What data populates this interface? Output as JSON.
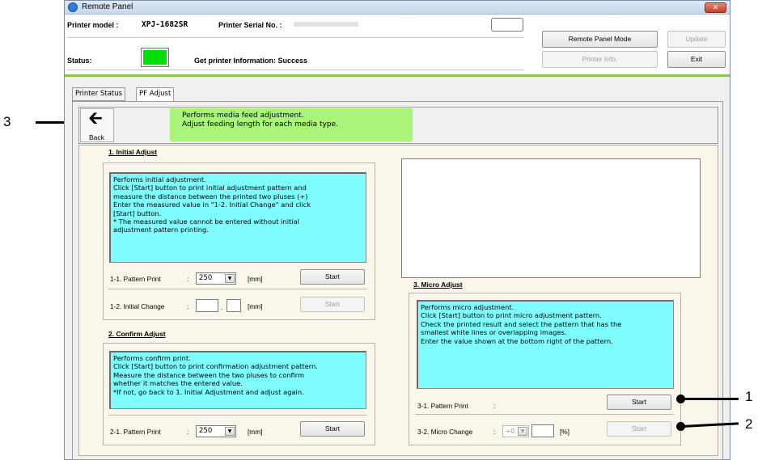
{
  "window": {
    "title": "Remote Panel",
    "close_symbol": "✕"
  },
  "header": {
    "printer_model_label": "Printer model :",
    "printer_model_value": "XPJ-1682SR",
    "serial_label": "Printer Serial No. :",
    "status_label": "Status:",
    "status_color": "#00e000",
    "status_message": "Get printer Information: Success",
    "remote_panel_mode_button": "Remote Panel Mode",
    "update_button": "Update",
    "printer_info_button": "Printer Info.",
    "exit_button": "Exit"
  },
  "tabs": [
    {
      "label": "Printer Status"
    },
    {
      "label": "PF Adjust"
    }
  ],
  "toolbar": {
    "back_label": "Back",
    "back_arrow": "🡰",
    "description": "Performs media feed adjustment.\nAdjust feeding length for each media type."
  },
  "initial_adjust": {
    "title": "1.   Initial Adjust",
    "description": "Performs initial adjustment.\nClick [Start] button to print initial adjustment pattern and\nmeasure the distance between the printed two pluses (+)\nEnter the measured value in \"1-2. Initial Change\" and click\n[Start] button.\n * The measured value cannot be entered without initial\nadjustment pattern printing.",
    "pattern_print_label": "1-1.   Pattern Print",
    "pattern_print_colon": ":",
    "pattern_print_value": "250",
    "pattern_print_unit": "[mm]",
    "pattern_print_button": "Start",
    "initial_change_label": "1-2.   Initial Change",
    "initial_change_colon": ":",
    "initial_change_sep": ".",
    "initial_change_unit": "[mm]",
    "initial_change_button": "Start"
  },
  "confirm_adjust": {
    "title": "2.   Confirm Adjust",
    "description": "Performs confirm print.\nClick [Start] button to print confirmation adjustment pattern.\nMeasure the distance between the two pluses to confirm\nwhether it matches the entered value.\n*If not, go back to 1. Initial Adjustment and adjust again.",
    "pattern_print_label": "2-1.   Pattern Print",
    "pattern_print_colon": ":",
    "pattern_print_value": "250",
    "pattern_print_unit": "[mm]",
    "pattern_print_button": "Start"
  },
  "micro_adjust": {
    "title": "3.   Micro Adjust",
    "description": "Performs micro adjustment.\nClick [Start] button to print micro adjustment pattern.\nCheck the printed result and select the pattern that has the\nsmallest white lines or overlapping images.\nEnter the value shown at the bottom right of the pattern.",
    "pattern_print_label": "3-1.   Pattern Print",
    "pattern_print_colon": ":",
    "pattern_print_button": "Start",
    "micro_change_label": "3-2.   Micro Change",
    "micro_change_colon": ":",
    "micro_change_sign": "+0.",
    "micro_change_unit": "[%]",
    "micro_change_button": "Start"
  },
  "callouts": [
    "1",
    "2",
    "3"
  ]
}
